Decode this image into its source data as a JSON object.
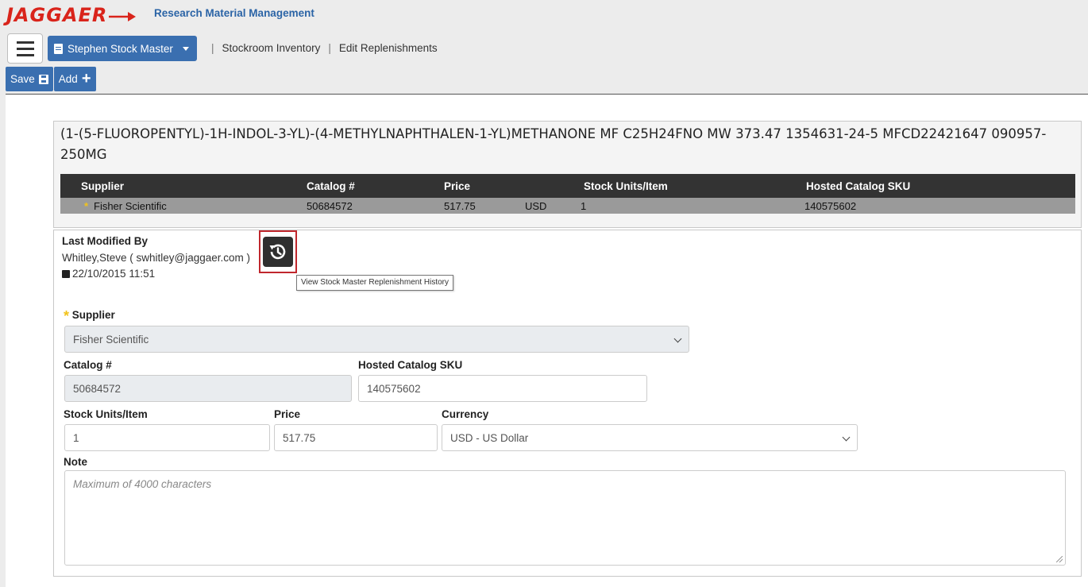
{
  "header": {
    "logo_text": "JAGGAER",
    "app_title": "Research Material Management",
    "stock_master_button": "Stephen Stock Master",
    "breadcrumb": [
      "Stockroom Inventory",
      "Edit Replenishments"
    ],
    "separator": "|"
  },
  "toolbar": {
    "save_label": "Save",
    "add_label": "Add"
  },
  "product": {
    "title": "(1-(5-FLUOROPENTYL)-1H-INDOL-3-YL)-(4-METHYLNAPHTHALEN-1-YL)METHANONE MF C25H24FNO MW 373.47 1354631-24-5 MFCD22421647 090957-250MG"
  },
  "grid": {
    "columns": [
      "Supplier",
      "Catalog #",
      "Price",
      "",
      "Stock Units/Item",
      "Hosted Catalog SKU"
    ],
    "row": {
      "star": "*",
      "supplier": "Fisher Scientific",
      "catalog": "50684572",
      "price": "517.75",
      "currency": "USD",
      "stock_units": "1",
      "sku": "140575602"
    }
  },
  "form": {
    "last_modified_label": "Last Modified By",
    "last_modified_by": "Whitley,Steve ( swhitley@jaggaer.com )",
    "last_modified_date": "22/10/2015 11:51",
    "history_tooltip": "View Stock Master Replenishment History",
    "supplier_label": "Supplier",
    "supplier_value": "Fisher Scientific",
    "catalog_label": "Catalog #",
    "catalog_value": "50684572",
    "sku_label": "Hosted Catalog SKU",
    "sku_value": "140575602",
    "stock_units_label": "Stock Units/Item",
    "stock_units_value": "1",
    "price_label": "Price",
    "price_value": "517.75",
    "currency_label": "Currency",
    "currency_value": "USD - US Dollar",
    "note_label": "Note",
    "note_placeholder": "Maximum of 4000 characters"
  },
  "colors": {
    "brand_red": "#d9241b",
    "primary_blue": "#3a6fb0",
    "required_star": "#f2c31b",
    "grid_header": "#333333",
    "highlight_border": "#c0272d"
  }
}
